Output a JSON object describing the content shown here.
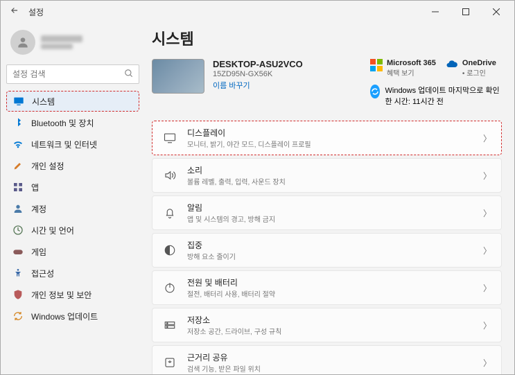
{
  "window": {
    "title": "설정"
  },
  "sidebar": {
    "search_placeholder": "설정 검색",
    "items": [
      {
        "label": "시스템"
      },
      {
        "label": "Bluetooth 및 장치"
      },
      {
        "label": "네트워크 및 인터넷"
      },
      {
        "label": "개인 설정"
      },
      {
        "label": "앱"
      },
      {
        "label": "계정"
      },
      {
        "label": "시간 및 언어"
      },
      {
        "label": "게임"
      },
      {
        "label": "접근성"
      },
      {
        "label": "개인 정보 및 보안"
      },
      {
        "label": "Windows 업데이트"
      }
    ]
  },
  "main": {
    "heading": "시스템",
    "device": {
      "name": "DESKTOP-ASU2VCO",
      "model": "15ZD95N-GX56K",
      "rename": "이름 바꾸기"
    },
    "promo": {
      "m365": {
        "title": "Microsoft 365",
        "sub": "혜택 보기"
      },
      "onedrive": {
        "title": "OneDrive",
        "sub": "• 로그인"
      },
      "wu": {
        "title": "Windows 업데이트",
        "sub": "마지막으로 확인한 시간: 11시간 전"
      }
    },
    "rows": [
      {
        "title": "디스플레이",
        "sub": "모니터, 밝기, 야간 모드, 디스플레이 프로필"
      },
      {
        "title": "소리",
        "sub": "볼륨 레벨, 출력, 입력, 사운드 장치"
      },
      {
        "title": "알림",
        "sub": "앱 및 시스템의 경고, 방해 금지"
      },
      {
        "title": "집중",
        "sub": "방해 요소 줄이기"
      },
      {
        "title": "전원 및 배터리",
        "sub": "절전, 배터리 사용, 배터리 절약"
      },
      {
        "title": "저장소",
        "sub": "저장소 공간, 드라이브, 구성 규칙"
      },
      {
        "title": "근거리 공유",
        "sub": "검색 기능, 받은 파일 위치"
      }
    ]
  }
}
